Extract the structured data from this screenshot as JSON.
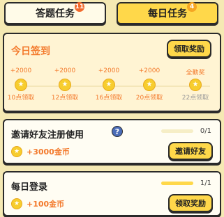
{
  "tabs": [
    {
      "label": "答题任务",
      "badge": "11"
    },
    {
      "label": "每日任务",
      "badge": "4"
    }
  ],
  "checkin": {
    "title": "今日签到",
    "button": "领取奖励",
    "steps": [
      {
        "amount": "+2000",
        "time": "10点领取"
      },
      {
        "amount": "+2000",
        "time": "12点领取"
      },
      {
        "amount": "+2000",
        "time": "16点领取"
      },
      {
        "amount": "+2000",
        "time": "20点领取"
      },
      {
        "amount": "全勤奖",
        "time": "22点领取"
      }
    ]
  },
  "invite": {
    "title": "邀请好友注册使用",
    "help_icon": "question-icon",
    "reward": "+3000金币",
    "progress_text": "0/1",
    "progress": 0,
    "button": "邀请好友"
  },
  "login": {
    "title": "每日登录",
    "reward": "+100金币",
    "progress_text": "1/1",
    "progress": 1,
    "button": "领取奖励"
  },
  "coin_glyph": "★",
  "help_glyph": "?"
}
